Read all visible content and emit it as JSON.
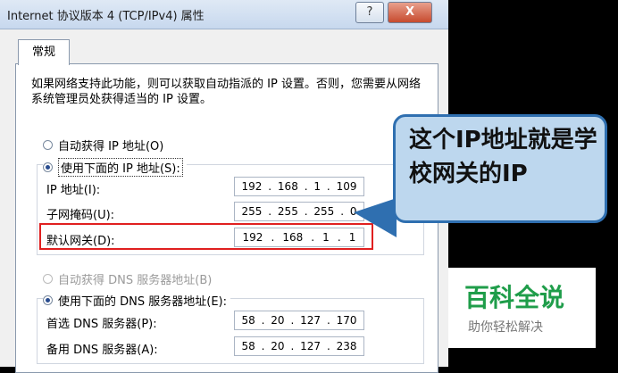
{
  "window": {
    "title": "Internet 协议版本 4 (TCP/IPv4) 属性",
    "help_label": "?",
    "close_label": "X"
  },
  "tab": {
    "label": "常规"
  },
  "description": "如果网络支持此功能，则可以获取自动指派的 IP 设置。否则，您需要从网络系统管理员处获得适当的 IP 设置。",
  "ip": {
    "auto_label": "自动获得 IP 地址(O)",
    "manual_label": "使用下面的 IP 地址(S):",
    "selected": "manual",
    "fields": [
      {
        "label": "IP 地址(I):",
        "octets": [
          "192",
          "168",
          "1",
          "109"
        ]
      },
      {
        "label": "子网掩码(U):",
        "octets": [
          "255",
          "255",
          "255",
          "0"
        ]
      },
      {
        "label": "默认网关(D):",
        "octets": [
          "192",
          "168",
          "1",
          "1"
        ]
      }
    ]
  },
  "dns": {
    "auto_label": "自动获得 DNS 服务器地址(B)",
    "manual_label": "使用下面的 DNS 服务器地址(E):",
    "selected": "manual",
    "fields": [
      {
        "label": "首选 DNS 服务器(P):",
        "octets": [
          "58",
          "20",
          "127",
          "170"
        ]
      },
      {
        "label": "备用 DNS 服务器(A):",
        "octets": [
          "58",
          "20",
          "127",
          "238"
        ]
      }
    ]
  },
  "callout": {
    "text": "这个IP地址就是学校网关的IP"
  },
  "watermark": {
    "title": "百科全说",
    "subtitle": "助你轻松解决"
  },
  "colors": {
    "highlight": "#e02020",
    "callout_fill": "#bdd7ee",
    "callout_border": "#2f6fb0",
    "watermark": "#1f9d4a"
  }
}
